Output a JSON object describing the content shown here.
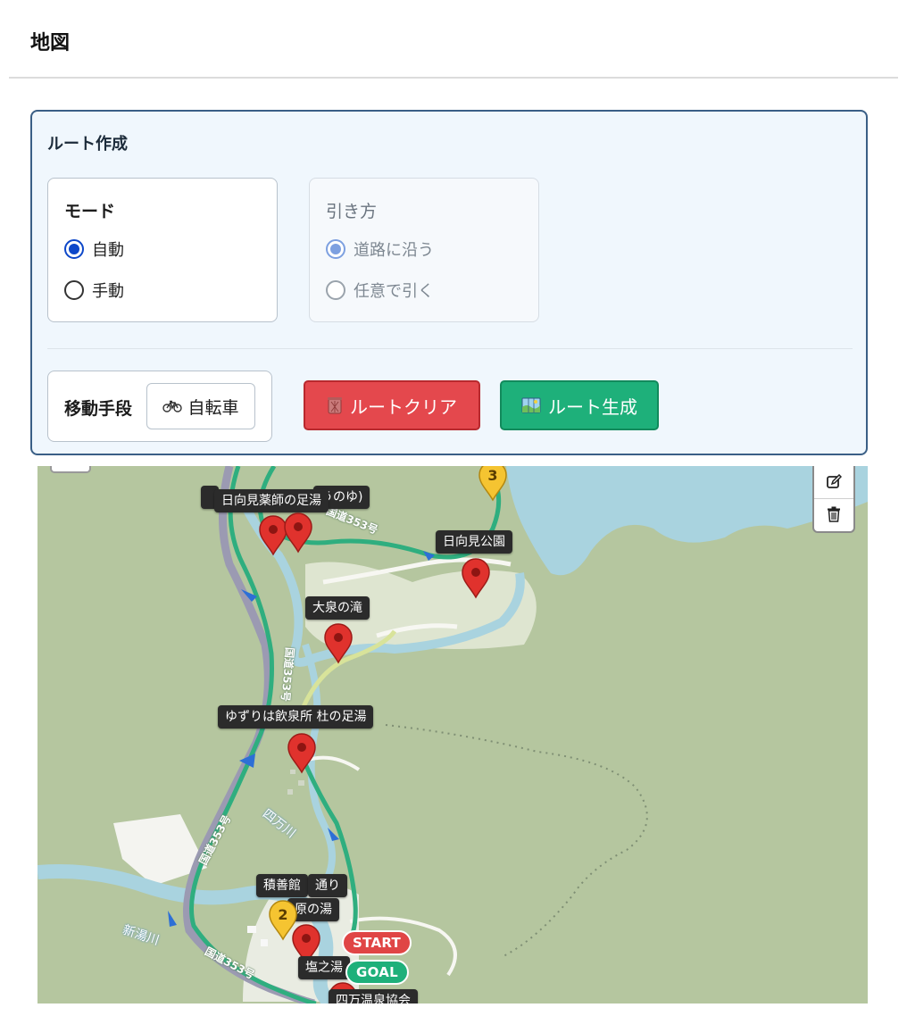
{
  "page": {
    "title": "地図"
  },
  "panel": {
    "title": "ルート作成",
    "mode": {
      "legend": "モード",
      "options": [
        {
          "label": "自動",
          "checked": true
        },
        {
          "label": "手動",
          "checked": false
        }
      ]
    },
    "draw": {
      "legend": "引き方",
      "options": [
        {
          "label": "道路に沿う",
          "checked": true
        },
        {
          "label": "任意で引く",
          "checked": false
        }
      ]
    },
    "transport": {
      "label": "移動手段",
      "value": "自転車",
      "icon": "bicycle-icon"
    },
    "buttons": {
      "clear": {
        "label": "ルートクリア",
        "icon": "wastebasket-icon",
        "color": "#e4484d"
      },
      "generate": {
        "label": "ルート生成",
        "icon": "map-icon",
        "color": "#1eb07a"
      }
    }
  },
  "map": {
    "tooltips": [
      "日向見薬師の足湯",
      "うのゆ)",
      "日向見公園",
      "大泉の滝",
      "ゆずりは飲泉所 杜の足湯",
      "積善館",
      "通り",
      "原の湯",
      "塩之湯",
      "四万温泉協会"
    ],
    "waypoints": {
      "two": "2",
      "three": "3"
    },
    "pills": {
      "start": "START",
      "goal": "GOAL"
    },
    "road_labels": [
      "国道353号",
      "国道353号",
      "国道353号",
      "国道353号"
    ],
    "river_labels": [
      "四万川",
      "新湯川"
    ],
    "controls": {
      "edit_icon": "edit-icon",
      "trash_icon": "trash-icon"
    },
    "colors": {
      "route": "#2fae7f",
      "pin": "#e0322d",
      "waypoint": "#f5c431"
    }
  }
}
